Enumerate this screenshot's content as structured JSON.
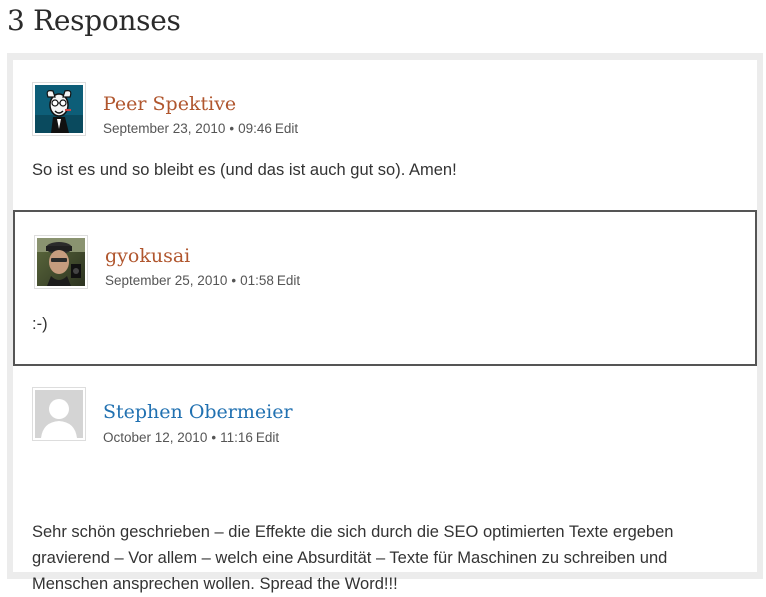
{
  "heading": "3 Responses",
  "comments": [
    {
      "author": "Peer Spektive",
      "date": "September 23, 2010",
      "separator": "•",
      "time": "09:46",
      "edit": "Edit",
      "text": "So ist es und so bleibt es (und das ist auch gut so). Amen!",
      "avatar": "cartoon-avatar-icon",
      "author_color": "#b0562e"
    },
    {
      "author": "gyokusai",
      "date": "September 25, 2010",
      "separator": "•",
      "time": "01:58",
      "edit": "Edit",
      "text": ":-)",
      "avatar": "photo-avatar-icon",
      "author_color": "#b0562e"
    },
    {
      "author": "Stephen Obermeier",
      "date": "October 12, 2010",
      "separator": "•",
      "time": "11:16",
      "edit": "Edit",
      "text": "Sehr schön geschrieben – die Effekte die sich durch die SEO optimierten Texte ergeben gravierend – Vor allem – welch eine Absurdität – Texte für Maschinen zu schreiben und Menschen ansprechen wollen. Spread the Word!!!",
      "avatar": "default-avatar-icon",
      "author_color": "#2171b1"
    }
  ]
}
